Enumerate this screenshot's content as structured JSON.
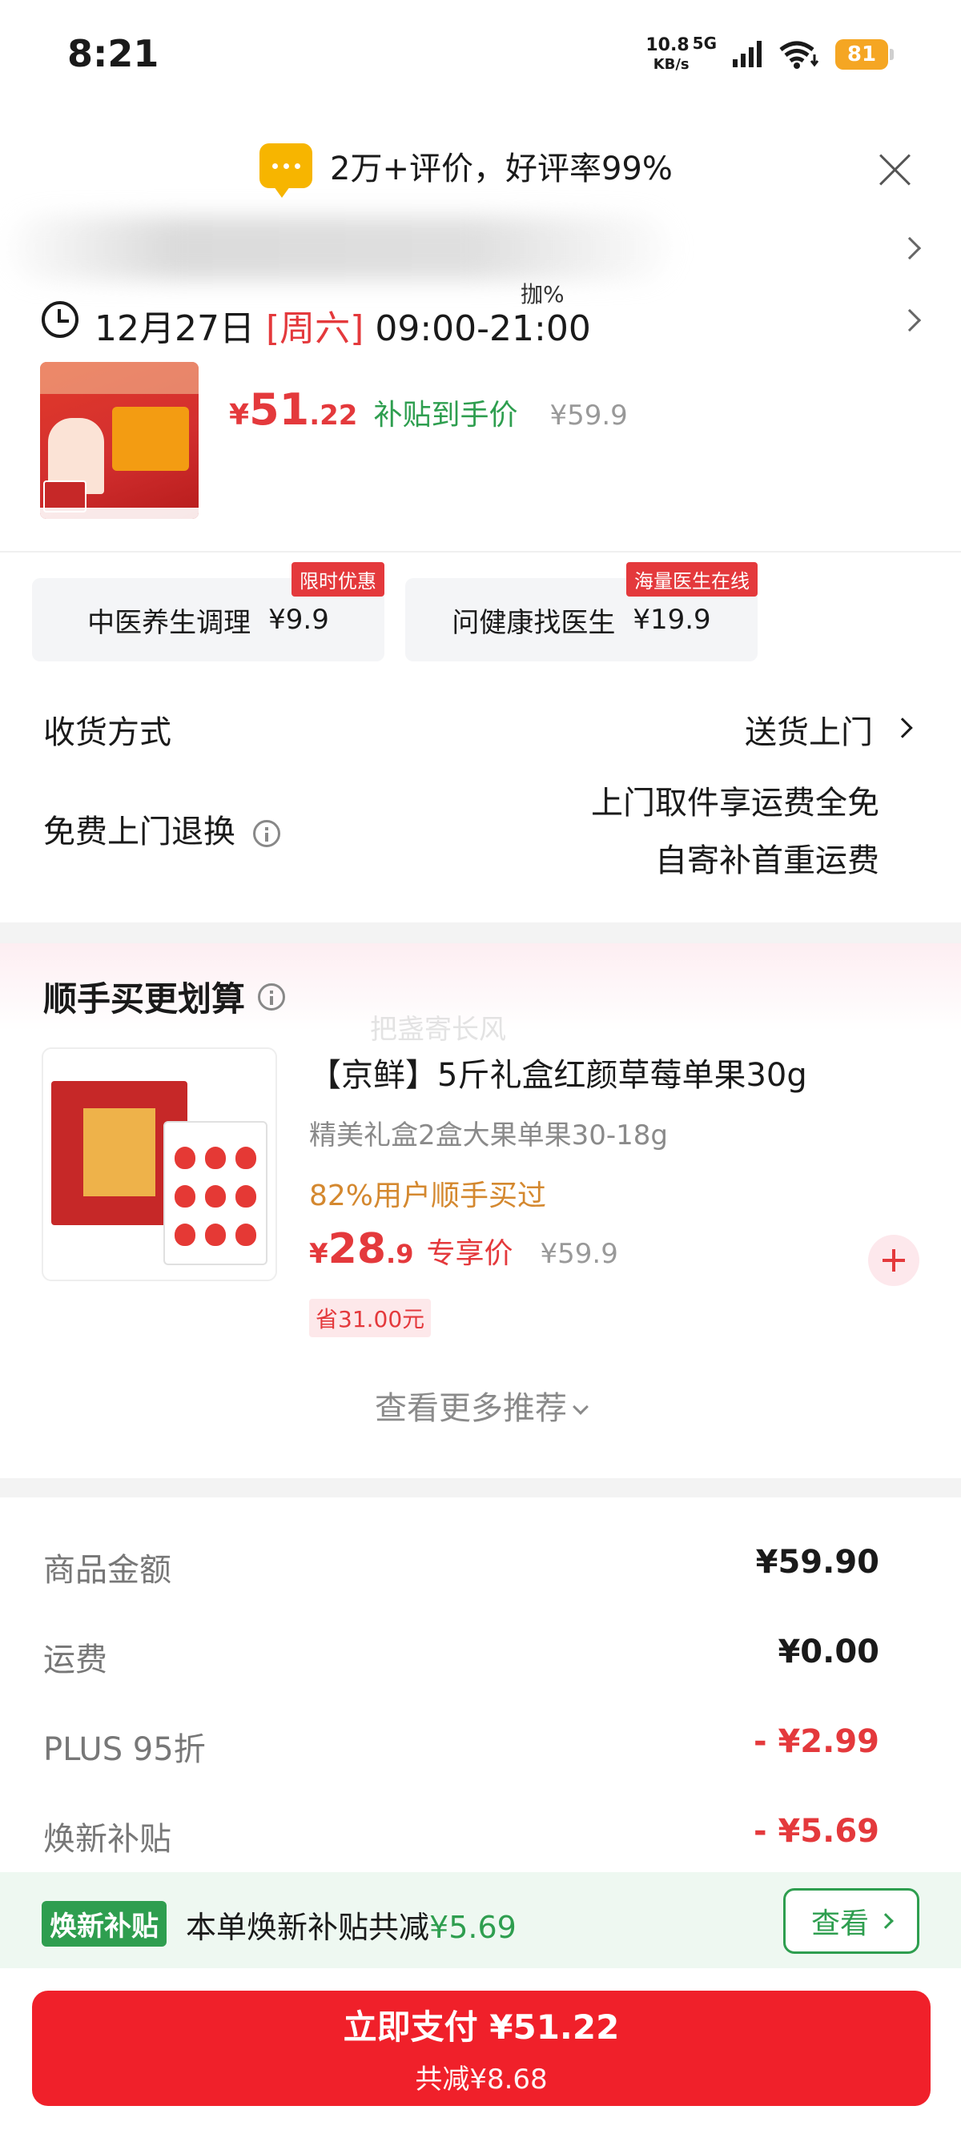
{
  "status_bar": {
    "time": "8:21",
    "net_speed": "10.8",
    "net_unit": "KB/s",
    "network": "5G",
    "battery": "81"
  },
  "review_banner": {
    "text": "2万+评价，好评率99%"
  },
  "delivery_time": {
    "date": "12月27日",
    "weekday": "[周六]",
    "window": "09:00-21:00",
    "mark": "拁%"
  },
  "product": {
    "currency": "¥",
    "price_int": "51",
    "price_dec": ".22",
    "subsidy_label": "补贴到手价",
    "original_price": "¥59.9"
  },
  "services": [
    {
      "name": "中医养生调理",
      "price": "¥9.9",
      "tag": "限时优惠"
    },
    {
      "name": "问健康找医生",
      "price": "¥19.9",
      "tag": "海量医生在线"
    }
  ],
  "delivery_method": {
    "label": "收货方式",
    "value": "送货上门"
  },
  "free_return": {
    "label": "免费上门退换",
    "line1": "上门取件享运费全免",
    "line2": "自寄补首重运费"
  },
  "recommendation": {
    "title": "顺手买更划算",
    "watermark": "把盏寄长风",
    "item_name": "【京鲜】5斤礼盒红颜草莓单果30g",
    "item_spec": "精美礼盒2盒大果单果30-18g",
    "bought": "82%用户顺手买过",
    "currency": "¥",
    "price_int": "28",
    "price_dec": ".9",
    "exclusive_label": "专享价",
    "original_price": "¥59.9",
    "save_tag": "省31.00元",
    "more_label": "查看更多推荐"
  },
  "summary": {
    "rows": [
      {
        "label": "商品金额",
        "value": "¥59.90"
      },
      {
        "label": "运费",
        "value": "¥0.00"
      },
      {
        "label": "PLUS 95折",
        "value": "- ¥2.99"
      },
      {
        "label": "焕新补贴",
        "value": "- ¥5.69"
      }
    ]
  },
  "subsidy_bar": {
    "badge": "焕新补贴",
    "text": "本单焕新补贴共减",
    "amount": "¥5.69",
    "button": "查看"
  },
  "pay": {
    "main_label": "立即支付 ¥51.22",
    "sub_label": "共减¥8.68"
  },
  "colors": {
    "brand_red": "#e4393c",
    "subsidy_green": "#2e9e4f",
    "pay_button": "#f0202a",
    "battery": "#f5a623"
  }
}
